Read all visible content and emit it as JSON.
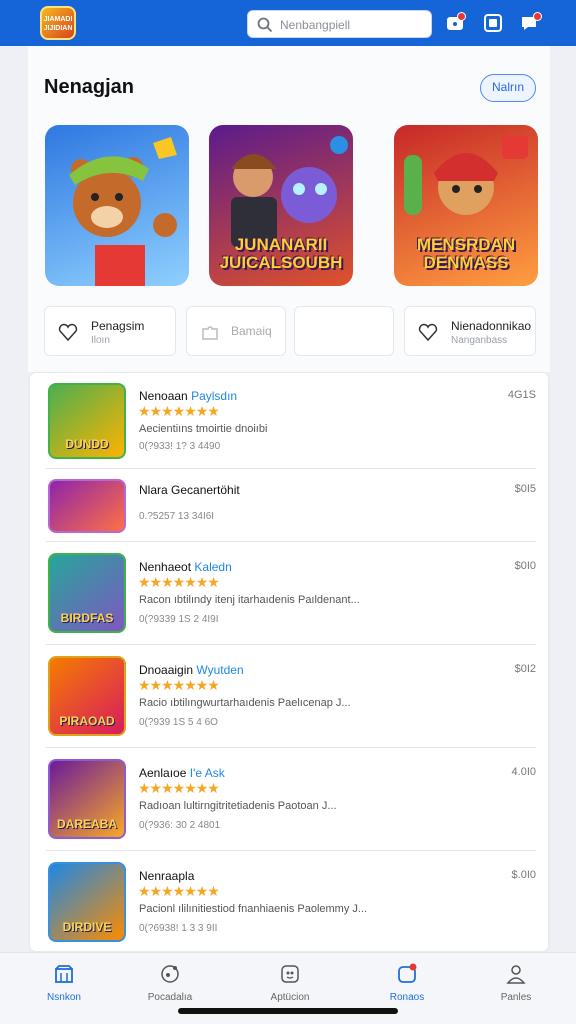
{
  "header": {
    "logo_text": "JIAMADI JIJIDIAN",
    "search_placeholder": "Nenbangpiell"
  },
  "section": {
    "title": "Nenagjan",
    "action_label": "Nalrın"
  },
  "featured": [
    {
      "label": "",
      "colors": [
        "#2e78e0",
        "#8fd0ff"
      ]
    },
    {
      "label": "JUNANARII JUICALSOUBH",
      "colors": [
        "#5b1b8c",
        "#e0522a"
      ]
    },
    {
      "label": "MENSRDAN DENMASS",
      "colors": [
        "#c62828",
        "#ff9e40"
      ]
    }
  ],
  "chips": [
    {
      "title": "Penagsim",
      "sub": "Iloın",
      "icon": "heart-icon"
    },
    {
      "title": "Bamaiq",
      "sub": "",
      "icon": "puzzle-icon"
    },
    {
      "title": "",
      "sub": "",
      "icon": ""
    },
    {
      "title": "Nienadonnikao",
      "sub": "Nanganbass",
      "icon": "heart-icon"
    }
  ],
  "list": [
    {
      "title": "Nenoaan",
      "title_hl": "Paylsdın",
      "stars": "★★★★★★★",
      "desc": "Aecientiıns tmoirtie dnoiıbi",
      "meta": "0(?933! 1? 3 4490",
      "price": "4G1S",
      "caption": "DUNDD",
      "colors": [
        "#4caf50",
        "#ffb300"
      ]
    },
    {
      "title": "Nlara Gecanertöhit",
      "title_hl": "",
      "stars": "",
      "desc": "",
      "meta": "0.?5257 13 34I6I",
      "price": "$0I5",
      "caption": "",
      "colors": [
        "#8e24aa",
        "#ff7043"
      ]
    },
    {
      "title": "Nenhaeot",
      "title_hl": "Kaledn",
      "stars": "★★★★★★★",
      "desc": "Racon ıbtilındy itenj itarhaıdenis Paıldenant...",
      "meta": "0(?9339 1S 2 4I9I",
      "price": "$0I0",
      "caption": "BIRDFAS",
      "colors": [
        "#26a69a",
        "#7e57c2"
      ]
    },
    {
      "title": "Dnoaaigin",
      "title_hl": "Wyutden",
      "stars": "★★★★★★★",
      "desc": "Racio ıbtilıngwurtarhaıdenis Paelıcenap J...",
      "meta": "0(?939 1S 5 4 6O",
      "price": "$0I2",
      "caption": "PIRAOAD",
      "colors": [
        "#f57c00",
        "#d81b60"
      ]
    },
    {
      "title": "Aenlaıoe",
      "title_hl": "I'e Ask",
      "stars": "★★★★★★★",
      "desc": "Radıoan lultirngitritetiadenis Paotoan J...",
      "meta": "0(?936: 30 2 4801",
      "price": "4.0I0",
      "caption": "DAREABA",
      "colors": [
        "#6a1b9a",
        "#f9a825"
      ]
    },
    {
      "title": "Nenraapla",
      "title_hl": "",
      "stars": "★★★★★★★",
      "desc": "Pacionl ılilınitiestiod fnanhiaenis Paolemmy J...",
      "meta": "0(?6938! 1 3 3 9II",
      "price": "$.0I0",
      "caption": "DIRDIVE",
      "colors": [
        "#1e88e5",
        "#fb8c00"
      ]
    }
  ],
  "nav": [
    {
      "label": "Nsnkon",
      "icon": "store-icon",
      "active": true
    },
    {
      "label": "Pocadalıa",
      "icon": "game-icon",
      "active": false
    },
    {
      "label": "Aptücion",
      "icon": "apps-icon",
      "active": false
    },
    {
      "label": "Ronaos",
      "icon": "notifications-icon",
      "active": true
    },
    {
      "label": "Panles",
      "icon": "profile-icon",
      "active": false
    }
  ],
  "colors": {
    "primary": "#1565d8",
    "star": "#f5a623",
    "highlight": "#1e88e5"
  }
}
